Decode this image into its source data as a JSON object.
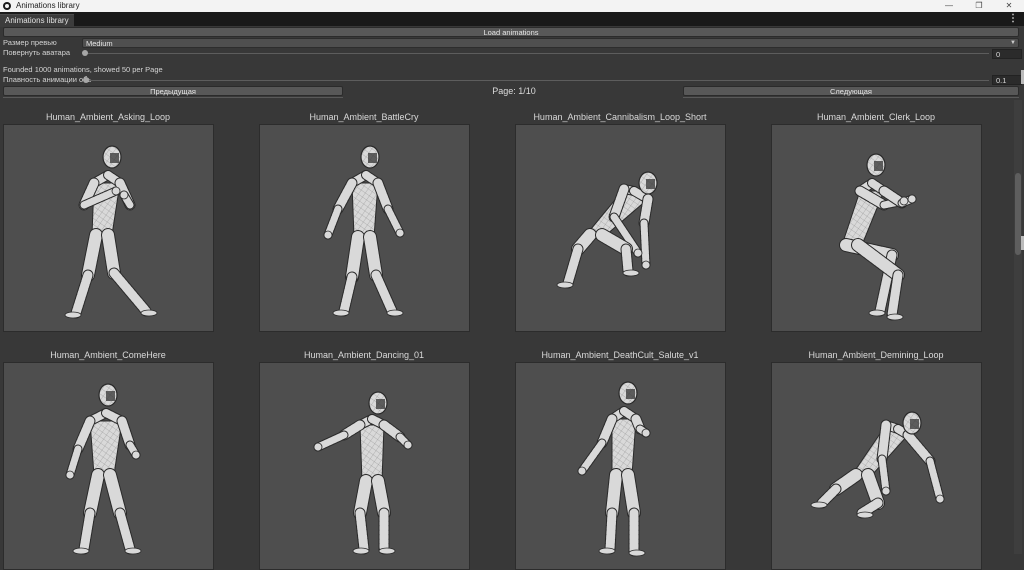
{
  "window": {
    "title": "Animations library",
    "minimize": "—",
    "maximize": "❐",
    "close": "✕"
  },
  "tab": {
    "label": "Animations library",
    "menu_glyph": "⋮"
  },
  "toolbar": {
    "load_label": "Load animations"
  },
  "settings": {
    "preview_size": {
      "label": "Размер превью",
      "value": "Medium",
      "arrow": "▼"
    },
    "rotate": {
      "label": "Повернуть аватара",
      "value": "0",
      "level": 0
    },
    "smoothness": {
      "label": "Плавность анимации обь",
      "value": "0.1",
      "level": 0
    }
  },
  "summary": "Founded 1000 animations, showed 50 per Page",
  "pagination": {
    "prev_label": "Предыдущая",
    "page_label": "Page: 1/10",
    "next_label": "Следующая"
  },
  "animations": [
    {
      "name": "Human_Ambient_Asking_Loop",
      "pose": "stand-guard"
    },
    {
      "name": "Human_Ambient_BattleCry",
      "pose": "stand-relaxed"
    },
    {
      "name": "Human_Ambient_Cannibalism_Loop_Short",
      "pose": "crouch"
    },
    {
      "name": "Human_Ambient_Clerk_Loop",
      "pose": "sit"
    },
    {
      "name": "Human_Ambient_ComeHere",
      "pose": "stand-wide"
    },
    {
      "name": "Human_Ambient_Dancing_01",
      "pose": "dance"
    },
    {
      "name": "Human_Ambient_DeathCult_Salute_v1",
      "pose": "salute"
    },
    {
      "name": "Human_Ambient_Demining_Loop",
      "pose": "kneel"
    }
  ]
}
